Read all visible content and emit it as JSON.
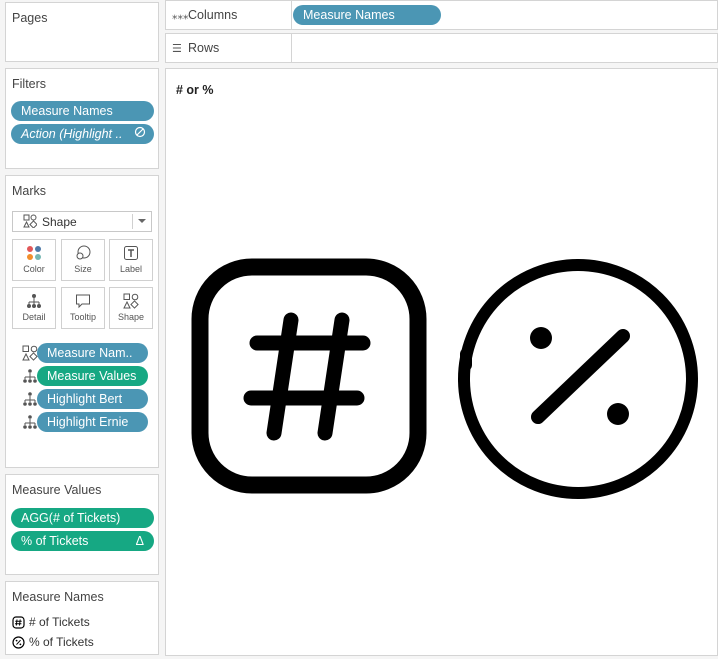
{
  "pages": {
    "title": "Pages"
  },
  "columns": {
    "label": "Columns",
    "pills": [
      "Measure Names"
    ]
  },
  "rows": {
    "label": "Rows"
  },
  "filters": {
    "title": "Filters",
    "pills": [
      "Measure Names",
      "Action (Highlight .."
    ]
  },
  "marks": {
    "title": "Marks",
    "mark_type": "Shape",
    "buttons": [
      "Color",
      "Size",
      "Label",
      "Detail",
      "Tooltip",
      "Shape"
    ],
    "fields": [
      {
        "icon": "shape-icon",
        "label": "Measure Nam..",
        "color": "blue"
      },
      {
        "icon": "detail-icon",
        "label": "Measure Values",
        "color": "green"
      },
      {
        "icon": "detail-icon",
        "label": "Highlight Bert",
        "color": "blue"
      },
      {
        "icon": "detail-icon",
        "label": "Highlight Ernie",
        "color": "blue"
      }
    ]
  },
  "measure_values": {
    "title": "Measure Values",
    "pills": [
      "AGG(# of Tickets)",
      "% of Tickets"
    ],
    "delta_symbol": "Δ"
  },
  "measure_names_legend": {
    "title": "Measure Names",
    "items": [
      "# of Tickets",
      "% of Tickets"
    ]
  },
  "view": {
    "header": "# or %"
  },
  "colors": {
    "blue_pill": "#4b96b4",
    "green_pill": "#16a883",
    "shape_stroke": "#000000"
  }
}
